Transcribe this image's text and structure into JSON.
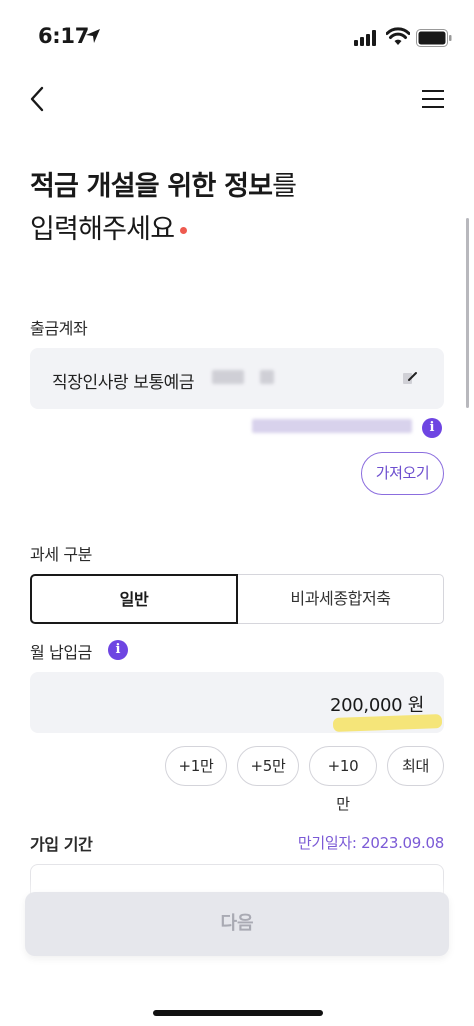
{
  "status": {
    "time": "6:17"
  },
  "title": {
    "bold": "적금 개설을 위한 정보",
    "rest1": "를",
    "line2": "입력해주세요"
  },
  "withdraw": {
    "label": "출금계좌",
    "account_name": "직장인사랑 보통예금",
    "fetch_label": "가져오기"
  },
  "tax": {
    "label": "과세 구분",
    "options": [
      "일반",
      "비과세종합저축"
    ],
    "selected": "일반"
  },
  "monthly": {
    "label": "월 납입금",
    "value": "200,000 원",
    "chips": [
      "+1만",
      "+5만",
      "+10만",
      "최대"
    ]
  },
  "period": {
    "label": "가입 기간",
    "maturity": "만기일자: 2023.09.08"
  },
  "next_label": "다음",
  "colors": {
    "accent": "#6e45e2",
    "red_dot": "#ee5a4f",
    "highlight": "#f5e04f"
  },
  "icons": [
    "location-arrow-icon",
    "cellular-signal-icon",
    "wifi-icon",
    "battery-icon",
    "back-chevron-icon",
    "hamburger-menu-icon",
    "edit-pencil-icon",
    "info-icon"
  ]
}
